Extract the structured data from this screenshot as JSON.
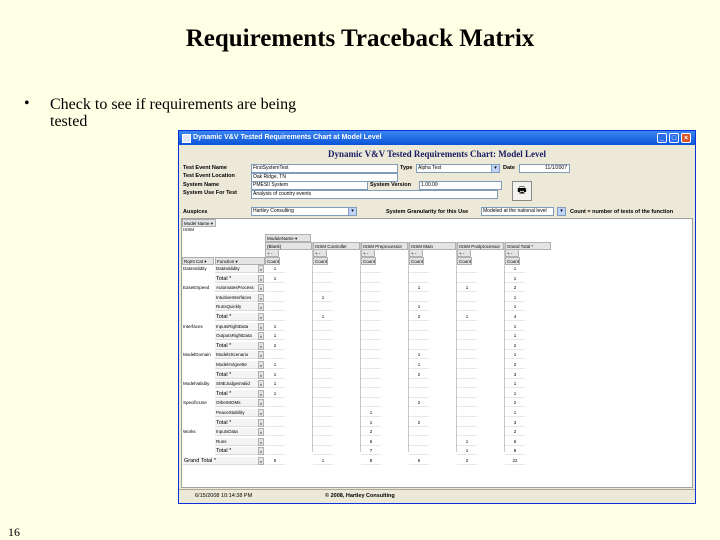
{
  "slide": {
    "title": "Requirements Traceback Matrix",
    "bullet": "Check to see if requirements are being tested",
    "page_number": "16"
  },
  "window": {
    "title": "Dynamic V&V Tested Requirements Chart at Model Level",
    "chart_heading": "Dynamic V&V Tested Requirements Chart: Model Level"
  },
  "form": {
    "test_event_name_label": "Test Event Name",
    "test_event_name": "FirstSystemTest",
    "type_label": "Type",
    "type_value": "Alpha Test",
    "date_label": "Date",
    "date_value": "11/1/2007",
    "location_label": "Test Event Location",
    "location_value": "Oak Ridge, TN",
    "system_name_label": "System Name",
    "system_name_value": "PMESII System",
    "system_version_label": "System Version",
    "system_version_value": "1.00.00",
    "system_use_label": "System Use For Test",
    "system_use_value": "Analysis of country events",
    "auspices_label": "Auspices",
    "auspices_value": "Hartley Consulting",
    "granularity_label": "System Granularity for this Use",
    "granularity_value": "Modeled at the national level",
    "count_note": "Count = number of tests of the function"
  },
  "pivot": {
    "model_name_label": "Model Name",
    "model_name_value": "ISSM",
    "module_name_label": "ModuleName",
    "right_cat_label": "Rqmt Cat",
    "function_label": "Function",
    "count_label": "Count",
    "grand_total_label": "Grand Total",
    "columns": [
      "(Blank)",
      "ISSM Controller",
      "ISSM Preprocessor",
      "ISSM Main",
      "ISSM Postprocessor",
      "Grand Total"
    ],
    "rows": [
      {
        "cat": "DataValidity",
        "func": "DataValidity",
        "v": [
          "1",
          "",
          "",
          "",
          "",
          "1"
        ]
      },
      {
        "cat": "",
        "func": "Total",
        "v": [
          "1",
          "",
          "",
          "",
          "",
          "1"
        ]
      },
      {
        "cat": "EaseESpeed",
        "func": "AutomatesProcess",
        "v": [
          "",
          "",
          "",
          "1",
          "1",
          "2"
        ]
      },
      {
        "cat": "",
        "func": "IntuitiveInterfaces",
        "v": [
          "",
          "1",
          "",
          "",
          "",
          "1"
        ]
      },
      {
        "cat": "",
        "func": "RunsQuickly",
        "v": [
          "",
          "",
          "",
          "1",
          "",
          "1"
        ]
      },
      {
        "cat": "",
        "func": "Total",
        "v": [
          "",
          "1",
          "",
          "2",
          "1",
          "4"
        ]
      },
      {
        "cat": "Interfaces",
        "func": "InputsRightData",
        "v": [
          "1",
          "",
          "",
          "",
          "",
          "1"
        ]
      },
      {
        "cat": "",
        "func": "OutputsRightData",
        "v": [
          "1",
          "",
          "",
          "",
          "",
          "1"
        ]
      },
      {
        "cat": "",
        "func": "Total",
        "v": [
          "2",
          "",
          "",
          "",
          "",
          "2"
        ]
      },
      {
        "cat": "ModelDomain",
        "func": "ModelsScenario",
        "v": [
          "",
          "",
          "",
          "1",
          "",
          "1"
        ]
      },
      {
        "cat": "",
        "func": "ModelsVignette",
        "v": [
          "1",
          "",
          "",
          "1",
          "",
          "2"
        ]
      },
      {
        "cat": "",
        "func": "Total",
        "v": [
          "1",
          "",
          "",
          "2",
          "",
          "3"
        ]
      },
      {
        "cat": "ModelValidity",
        "func": "SMEJudgesValid",
        "v": [
          "1",
          "",
          "",
          "",
          "",
          "1"
        ]
      },
      {
        "cat": "",
        "func": "Total",
        "v": [
          "1",
          "",
          "",
          "",
          "",
          "1"
        ]
      },
      {
        "cat": "SpecificUse",
        "func": "OtherMOMs",
        "v": [
          "",
          "",
          "",
          "2",
          "",
          "2"
        ]
      },
      {
        "cat": "",
        "func": "PeaceStability",
        "v": [
          "",
          "",
          "1",
          "",
          "",
          "1"
        ]
      },
      {
        "cat": "",
        "func": "Total",
        "v": [
          "",
          "",
          "1",
          "2",
          "",
          "3"
        ]
      },
      {
        "cat": "Works",
        "func": "InputsData",
        "v": [
          "",
          "",
          "2",
          "",
          "",
          "2"
        ]
      },
      {
        "cat": "",
        "func": "Runs",
        "v": [
          "",
          "",
          "5",
          "",
          "1",
          "6"
        ]
      },
      {
        "cat": "",
        "func": "Total",
        "v": [
          "",
          "",
          "7",
          "",
          "1",
          "8"
        ]
      }
    ],
    "grand_total_row": [
      "5",
      "1",
      "8",
      "6",
      "2",
      "22"
    ]
  },
  "status": {
    "timestamp": "6/15/2008 10:14:38 PM",
    "copyright": "© 2008, Hartley Consulting"
  }
}
